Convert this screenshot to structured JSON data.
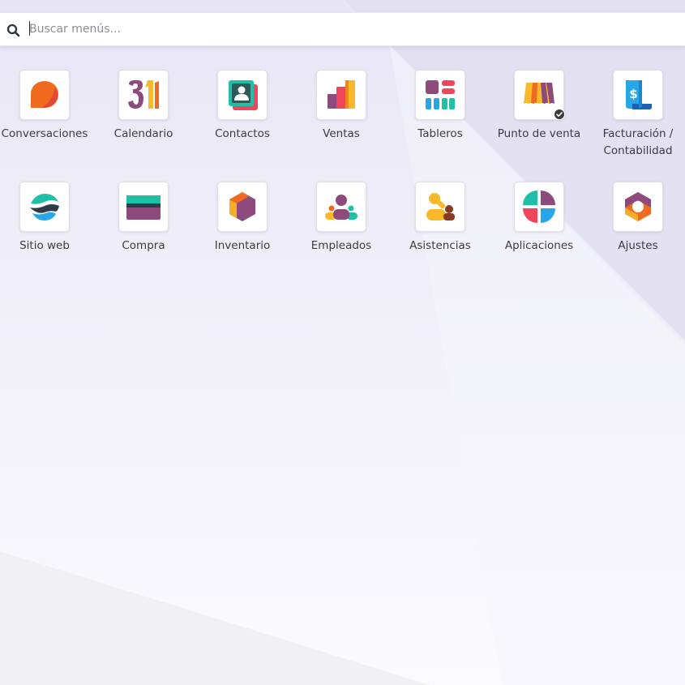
{
  "search": {
    "placeholder": "Buscar menús...",
    "value": ""
  },
  "apps": [
    {
      "id": "conversaciones",
      "label": "Conversaciones",
      "icon": "chat-bubble-icon"
    },
    {
      "id": "calendario",
      "label": "Calendario",
      "icon": "calendar-icon"
    },
    {
      "id": "contactos",
      "label": "Contactos",
      "icon": "contact-card-icon"
    },
    {
      "id": "ventas",
      "label": "Ventas",
      "icon": "bar-chart-icon"
    },
    {
      "id": "tableros",
      "label": "Tableros",
      "icon": "dashboard-tiles-icon"
    },
    {
      "id": "punto-de-venta",
      "label": "Punto de venta",
      "icon": "storefront-awning-icon"
    },
    {
      "id": "facturacion",
      "label": "Facturación / Contabilidad",
      "icon": "invoice-dollar-icon"
    },
    {
      "id": "sitio-web",
      "label": "Sitio web",
      "icon": "globe-waves-icon"
    },
    {
      "id": "compra",
      "label": "Compra",
      "icon": "credit-card-icon"
    },
    {
      "id": "inventario",
      "label": "Inventario",
      "icon": "hexagon-box-icon"
    },
    {
      "id": "empleados",
      "label": "Empleados",
      "icon": "people-group-icon"
    },
    {
      "id": "asistencias",
      "label": "Asistencias",
      "icon": "badge-person-icon"
    },
    {
      "id": "aplicaciones",
      "label": "Aplicaciones",
      "icon": "quadrant-circle-icon"
    },
    {
      "id": "ajustes",
      "label": "Ajustes",
      "icon": "hexagon-gear-icon"
    }
  ],
  "colors": {
    "orange": "#f06b1f",
    "purple": "#8d4a7c",
    "teal": "#1fbfa8",
    "blue": "#27a7e8",
    "red": "#f0455a",
    "yellow": "#f8b92a",
    "dark": "#2e3c48"
  }
}
